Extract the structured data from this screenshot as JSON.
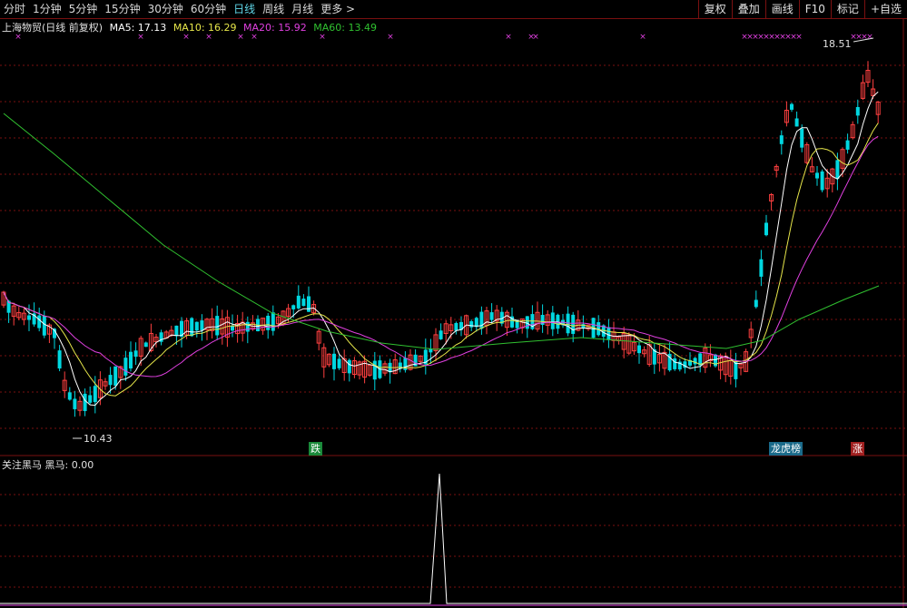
{
  "toolbar": {
    "periods": [
      "分时",
      "1分钟",
      "5分钟",
      "15分钟",
      "30分钟",
      "60分钟",
      "日线",
      "周线",
      "月线",
      "更多 >"
    ],
    "active_index": 6,
    "actions": [
      "复权",
      "叠加",
      "画线",
      "F10",
      "标记",
      "+自选"
    ]
  },
  "legend": {
    "title": "上海物贸(日线 前复权)",
    "ma5": "MA5: 17.13",
    "ma10": "MA10: 16.29",
    "ma20": "MA20: 15.92",
    "ma60": "MA60: 13.49"
  },
  "indicator": {
    "label": "关注黑马 黑马: 0.00"
  },
  "annotations": {
    "high": "18.51",
    "low": "10.43"
  },
  "tags": {
    "down": "跌",
    "list": "龙虎榜",
    "up": "涨"
  },
  "colors": {
    "up": "#ff4040",
    "down": "#00d7e0",
    "ma5": "#ffffff",
    "ma10": "#e6e64a",
    "ma20": "#e040e0",
    "ma60": "#30c030",
    "grid": "#7a1010"
  },
  "chart_data": {
    "type": "candlestick",
    "note_price_range": [
      10.43,
      18.51
    ],
    "ma_series": [
      "MA5",
      "MA10",
      "MA20",
      "MA60"
    ]
  }
}
